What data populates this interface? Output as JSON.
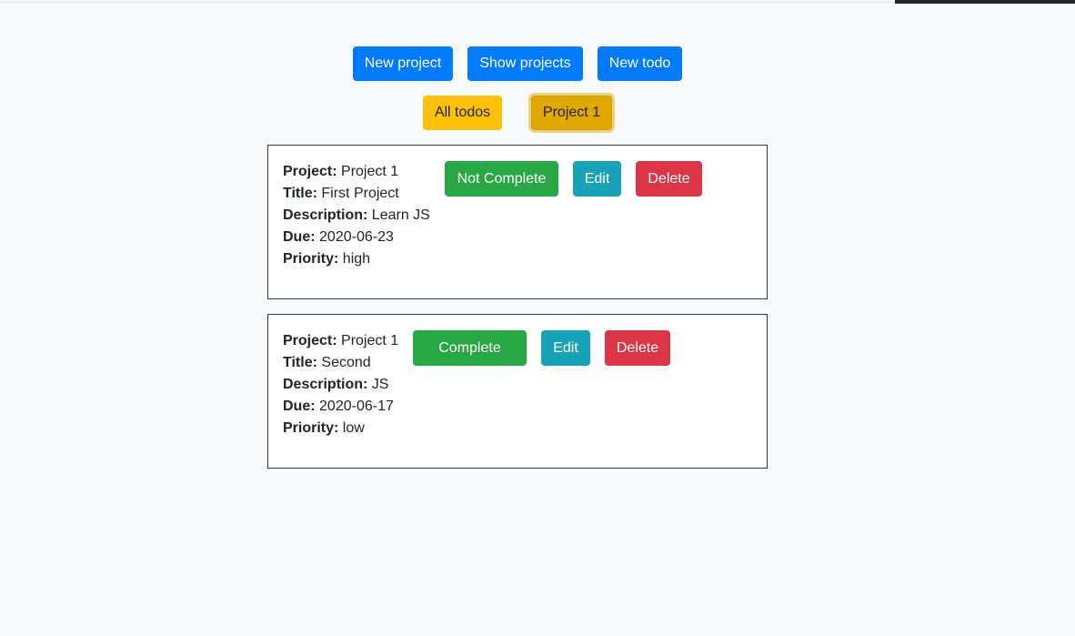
{
  "nav": {
    "new_project": "New project",
    "show_projects": "Show projects",
    "new_todo": "New todo"
  },
  "filters": {
    "all_todos": "All todos",
    "project_1": "Project 1"
  },
  "labels": {
    "project": "Project:",
    "title": "Title:",
    "description": "Description:",
    "due": "Due:",
    "priority": "Priority:"
  },
  "todos": [
    {
      "project": "Project 1",
      "title": "First Project",
      "description": "Learn JS",
      "due": "2020-06-23",
      "priority": "high",
      "status_label": "Not Complete",
      "edit_label": "Edit",
      "delete_label": "Delete"
    },
    {
      "project": "Project 1",
      "title": "Second",
      "description": "JS",
      "due": "2020-06-17",
      "priority": "low",
      "status_label": "Complete",
      "edit_label": "Edit",
      "delete_label": "Delete"
    }
  ],
  "colors": {
    "primary": "#007bff",
    "warning": "#ffc107",
    "success": "#28a745",
    "info": "#17a2b8",
    "danger": "#dc3545",
    "background": "#f8f9fa"
  }
}
